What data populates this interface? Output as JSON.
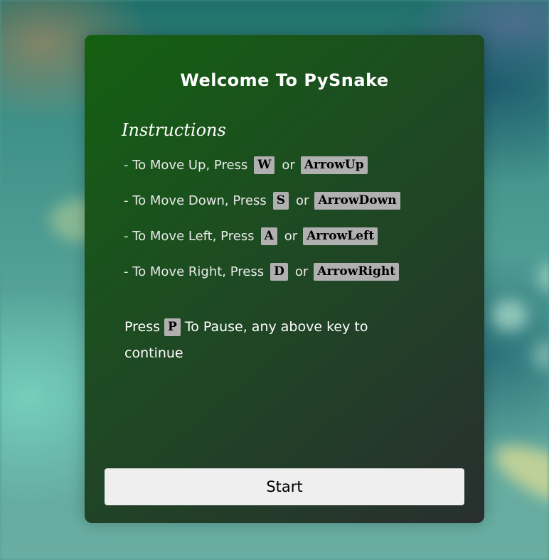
{
  "modal": {
    "title": "Welcome To PySnake",
    "instructions_heading": "Instructions",
    "controls": [
      {
        "text": "- To Move Up, Press",
        "key": "W",
        "or": "or",
        "alt_key": "ArrowUp"
      },
      {
        "text": "- To Move Down, Press",
        "key": "S",
        "or": "or",
        "alt_key": "ArrowDown"
      },
      {
        "text": "- To Move Left, Press",
        "key": "A",
        "or": "or",
        "alt_key": "ArrowLeft"
      },
      {
        "text": "- To Move Right, Press",
        "key": "D",
        "or": "or",
        "alt_key": "ArrowRight"
      }
    ],
    "pause": {
      "prefix": "Press",
      "key": "P",
      "suffix": "To Pause, any above key to continue"
    },
    "start_label": "Start"
  },
  "colors": {
    "modal_gradient_start": "#146011",
    "modal_gradient_end": "#282f2f",
    "key_background": "#b0b0b0",
    "button_background": "#efefef"
  }
}
